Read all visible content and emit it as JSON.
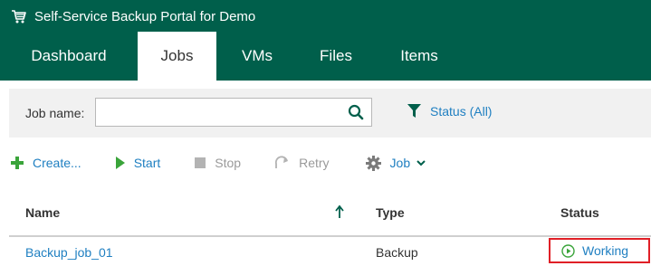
{
  "app": {
    "title": "Self-Service Backup Portal for Demo",
    "brand_color": "#005f4b",
    "logo_icon": "cart-icon"
  },
  "tabs": [
    {
      "label": "Dashboard",
      "active": false
    },
    {
      "label": "Jobs",
      "active": true
    },
    {
      "label": "VMs",
      "active": false
    },
    {
      "label": "Files",
      "active": false
    },
    {
      "label": "Items",
      "active": false
    }
  ],
  "filter": {
    "job_name_label": "Job name:",
    "search_value": "",
    "search_icon": "search-icon",
    "status_label": "Status (All)",
    "status_icon": "funnel-icon"
  },
  "toolbar": {
    "create_label": "Create...",
    "start_label": "Start",
    "stop_label": "Stop",
    "retry_label": "Retry",
    "job_label": "Job"
  },
  "table": {
    "columns": [
      "Name",
      "Type",
      "Status"
    ],
    "sorted_column": "Name",
    "sort_direction": "ascending",
    "rows": [
      {
        "name": "Backup_job_01",
        "type": "Backup",
        "status": "Working"
      }
    ]
  },
  "colors": {
    "link": "#1f7fc1",
    "disabled": "#9a9a9a",
    "highlight_border": "#e01f26"
  }
}
